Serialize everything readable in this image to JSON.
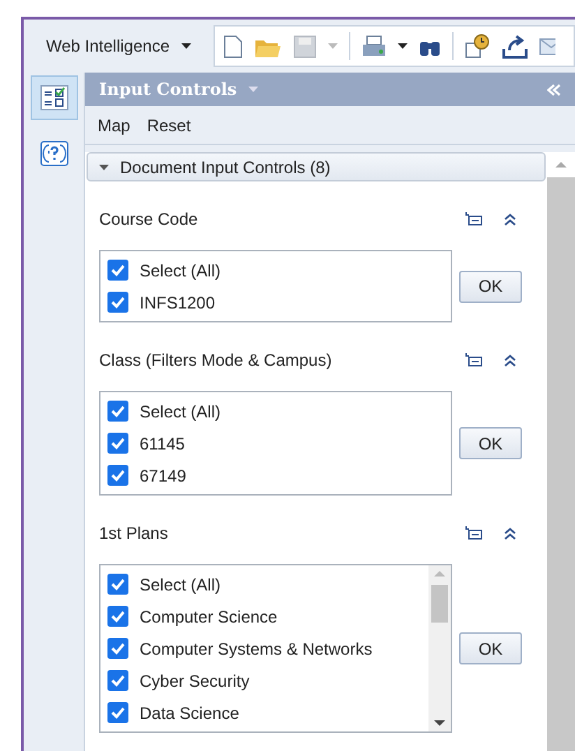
{
  "toolbar": {
    "app_menu": "Web Intelligence"
  },
  "side_rail": [
    {
      "kind": "controls",
      "selected": true
    },
    {
      "kind": "help",
      "selected": false
    }
  ],
  "panel": {
    "title": "Input Controls",
    "menu": [
      "Map",
      "Reset"
    ],
    "section": {
      "title": "Document Input Controls (8)",
      "expanded": true
    },
    "controls": [
      {
        "title": "Course Code",
        "kind": "list",
        "button": "OK",
        "items": [
          {
            "label": "Select (All)",
            "checked": true
          },
          {
            "label": "INFS1200",
            "checked": true
          }
        ]
      },
      {
        "title": "Class (Filters Mode & Campus)",
        "kind": "list",
        "button": "OK",
        "items": [
          {
            "label": "Select (All)",
            "checked": true
          },
          {
            "label": "61145",
            "checked": true
          },
          {
            "label": "67149",
            "checked": true
          }
        ]
      },
      {
        "title": "1st Plans",
        "kind": "scrolling-list",
        "button": "OK",
        "items": [
          {
            "label": "Select (All)",
            "checked": true
          },
          {
            "label": "Computer Science",
            "checked": true
          },
          {
            "label": "Computer Systems & Networks",
            "checked": true
          },
          {
            "label": "Cyber Security",
            "checked": true
          },
          {
            "label": "Data Science",
            "checked": true
          }
        ]
      }
    ]
  }
}
